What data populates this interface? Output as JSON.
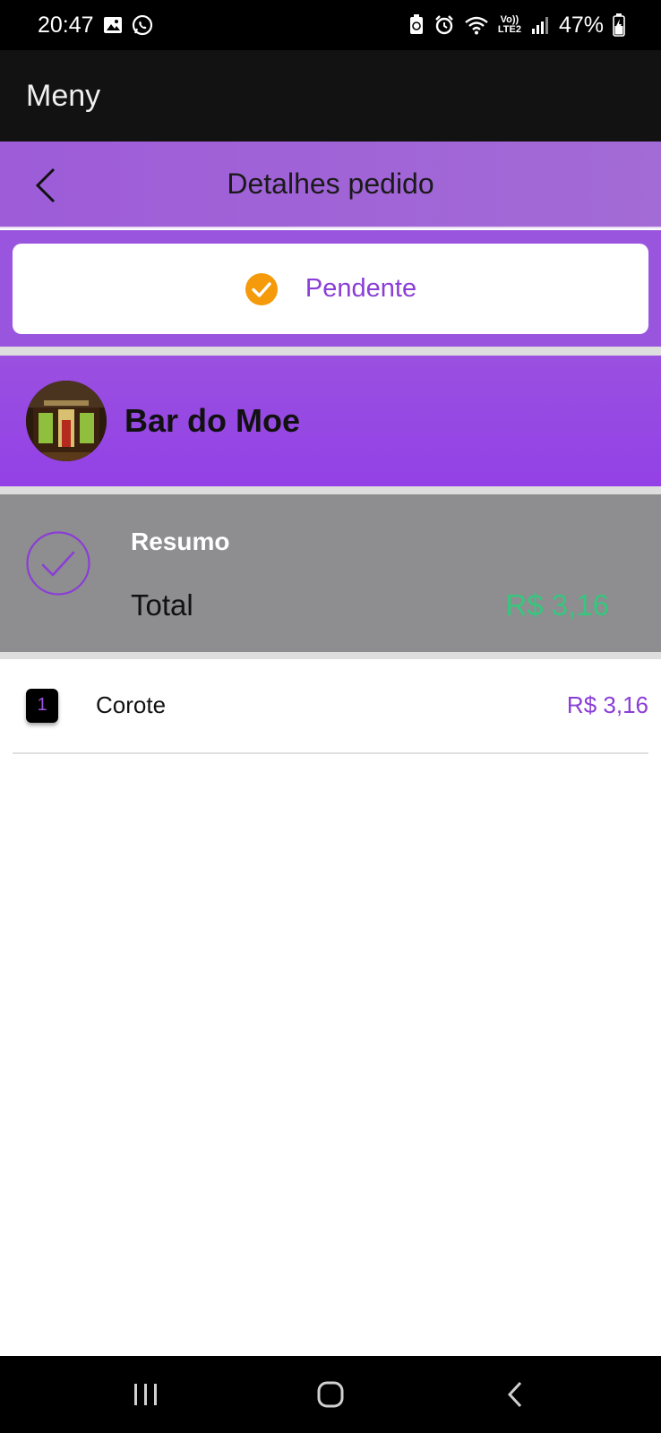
{
  "status_bar": {
    "time": "20:47",
    "network_top": "Vo))",
    "network_bottom": "LTE2",
    "battery": "47%"
  },
  "app_bar": {
    "title": "Meny"
  },
  "header": {
    "title": "Detalhes pedido",
    "back_icon": "chevron-left-icon"
  },
  "order_status": {
    "label": "Pendente",
    "icon": "check-circle-icon",
    "color": "#f59a0b"
  },
  "restaurant": {
    "name": "Bar do Moe"
  },
  "summary": {
    "title": "Resumo",
    "total_label": "Total",
    "total_value": "R$ 3,16"
  },
  "items": [
    {
      "qty": "1",
      "name": "Corote",
      "price": "R$ 3,16"
    }
  ],
  "colors": {
    "accent": "#9a55df",
    "status": "#f59a0b",
    "total": "#36c77f"
  }
}
